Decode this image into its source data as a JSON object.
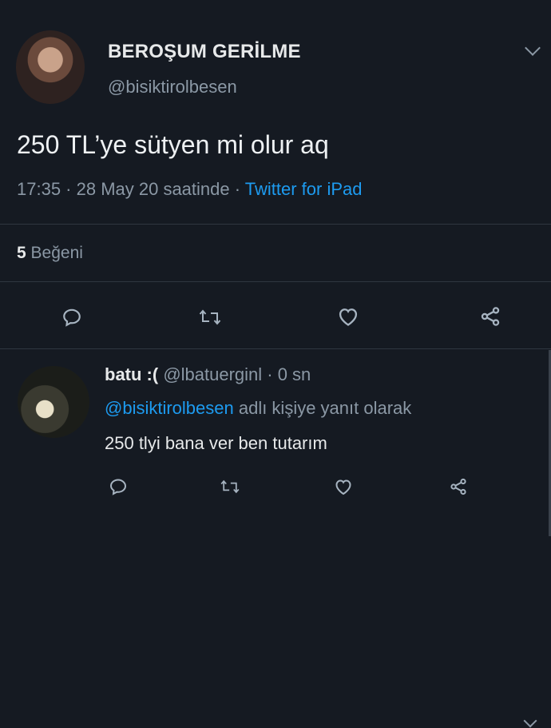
{
  "tweet": {
    "display_name": "BEROŞUM GERİLME",
    "handle": "@bisiktirolbesen",
    "text": "250 TL’ye sütyen mi olur aq",
    "time": "17:35 · 28 May 20 saatinde · ",
    "source": "Twitter for iPad",
    "likes_count": "5",
    "likes_label": " Beğeni",
    "icons": [
      "reply-icon",
      "retweet-icon",
      "like-icon",
      "share-icon"
    ]
  },
  "reply": {
    "display_name": "batu :(",
    "handle_time": " @lbatuerginl · 0 sn",
    "mention": "@bisiktirolbesen",
    "reply_to_suffix": " adlı kişiye yanıt olarak",
    "text": "250 tlyi bana ver ben tutarım",
    "icons": [
      "reply-icon",
      "retweet-icon",
      "like-icon",
      "share-icon"
    ]
  },
  "colors": {
    "background": "#151a22",
    "link": "#1d9bf0",
    "secondary_text": "#8b98a5"
  }
}
